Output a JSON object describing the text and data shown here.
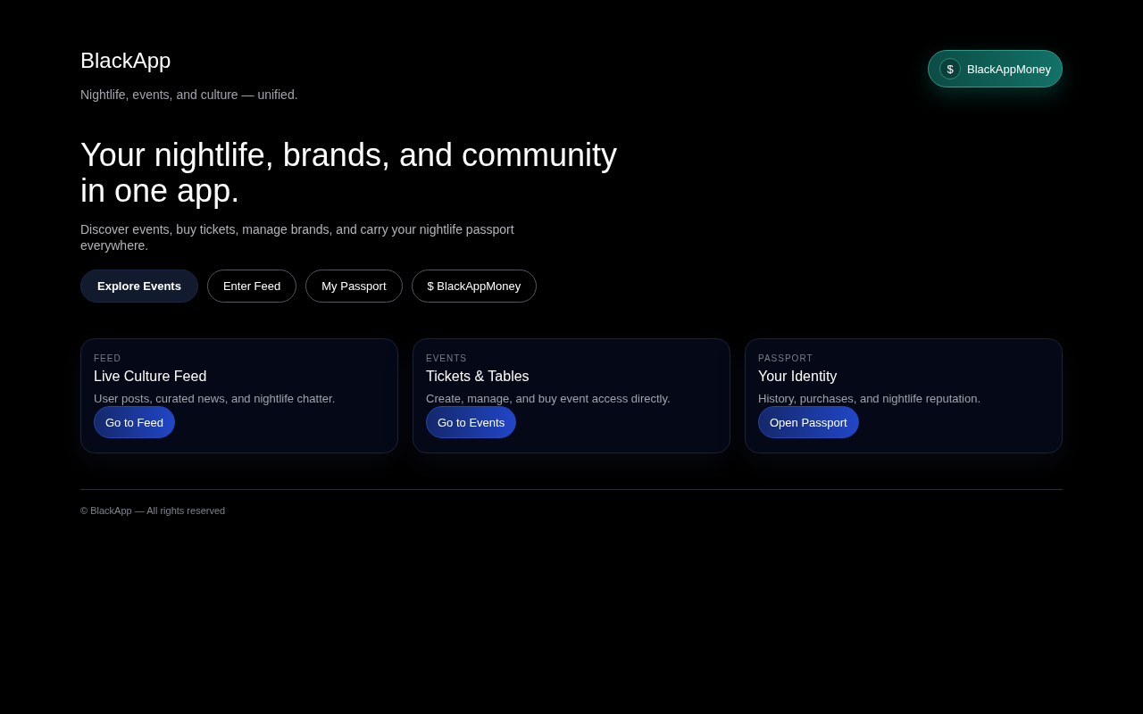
{
  "brand": {
    "title": "BlackApp",
    "tagline": "Nightlife, events, and culture — unified."
  },
  "wallet_pill": {
    "icon": "$",
    "label": "BlackAppMoney"
  },
  "hero": {
    "headline": "Your nightlife, brands, and community in one app.",
    "description": "Discover events, buy tickets, manage brands, and carry your nightlife passport everywhere."
  },
  "actions": [
    {
      "label": "Explore Events",
      "kind": "primary"
    },
    {
      "label": "Enter Feed",
      "kind": "outline"
    },
    {
      "label": "My Passport",
      "kind": "outline"
    },
    {
      "label": "$ BlackAppMoney",
      "kind": "outline"
    }
  ],
  "cards": [
    {
      "eyebrow": "FEED",
      "title": "Live Culture Feed",
      "description": "User posts, curated news, and nightlife chatter.",
      "button": "Go to Feed"
    },
    {
      "eyebrow": "EVENTS",
      "title": "Tickets & Tables",
      "description": "Create, manage, and buy event access directly.",
      "button": "Go to Events"
    },
    {
      "eyebrow": "PASSPORT",
      "title": "Your Identity",
      "description": "History, purchases, and nightlife reputation.",
      "button": "Open Passport"
    }
  ],
  "footer": "© BlackApp — All rights reserved"
}
